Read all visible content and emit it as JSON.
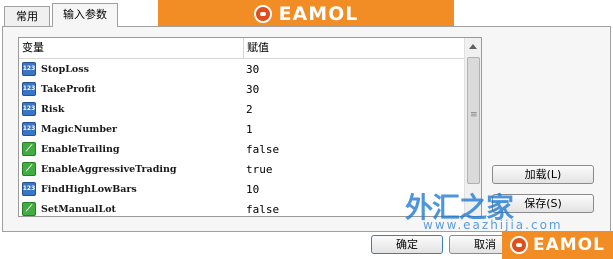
{
  "tabs": [
    {
      "label": "常用",
      "active": false
    },
    {
      "label": "输入参数",
      "active": true
    }
  ],
  "watermark": {
    "brand": "EAMOL",
    "cn_text": "外汇之家",
    "cn_badge": "EA",
    "url": "www.eazhijia.com"
  },
  "grid": {
    "columns": [
      "变量",
      "赋值"
    ],
    "rows": [
      {
        "icon": "number-type-icon",
        "icon_text": "123",
        "name": "StopLoss",
        "value": "30"
      },
      {
        "icon": "number-type-icon",
        "icon_text": "123",
        "name": "TakeProfit",
        "value": "30"
      },
      {
        "icon": "number-type-icon",
        "icon_text": "123",
        "name": "Risk",
        "value": "2"
      },
      {
        "icon": "number-type-icon",
        "icon_text": "123",
        "name": "MagicNumber",
        "value": "1"
      },
      {
        "icon": "boolean-type-icon",
        "icon_text": "⟋",
        "name": "EnableTrailing",
        "value": "false"
      },
      {
        "icon": "boolean-type-icon",
        "icon_text": "⟋",
        "name": "EnableAggressiveTrading",
        "value": "true"
      },
      {
        "icon": "number-type-icon",
        "icon_text": "123",
        "name": "FindHighLowBars",
        "value": "10"
      },
      {
        "icon": "boolean-type-icon",
        "icon_text": "⟋",
        "name": "SetManualLot",
        "value": "false"
      }
    ]
  },
  "buttons": {
    "load": "加载(L)",
    "save": "保存(S)",
    "ok": "确定",
    "cancel": "取消"
  },
  "colors": {
    "banner": "#f28c24",
    "number_icon": "#3a74c4",
    "boolean_icon": "#3fae3f"
  }
}
